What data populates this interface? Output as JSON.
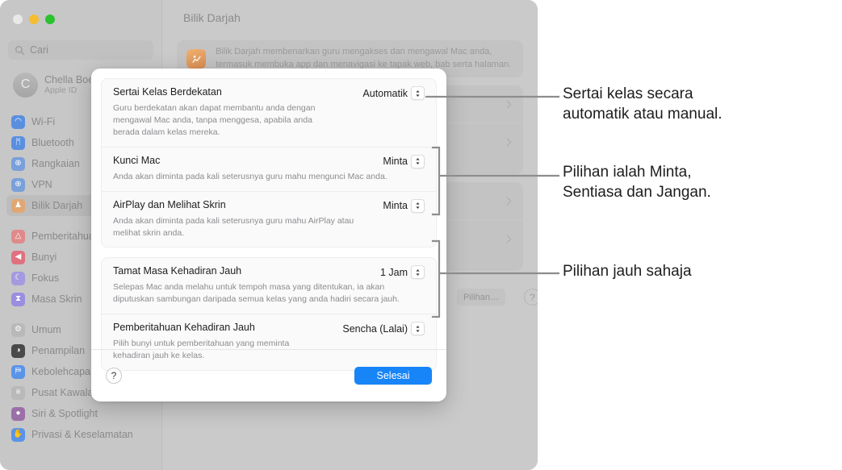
{
  "window": {
    "traffic_lights": [
      "close",
      "minimize",
      "zoom"
    ],
    "search": {
      "placeholder": "Cari",
      "value": ""
    },
    "account": {
      "name": "Chella Boe",
      "subtitle": "Apple ID",
      "initial": "C"
    },
    "sidebar_items": [
      {
        "label": "Wi-Fi",
        "icon": "wifi-icon",
        "color": "#5a8fe0",
        "glyph": "◠"
      },
      {
        "label": "Bluetooth",
        "icon": "bluetooth-icon",
        "color": "#5a8fe0",
        "glyph": "ᛗ"
      },
      {
        "label": "Rangkaian",
        "icon": "network-icon",
        "color": "#7aa0da",
        "glyph": "⊕"
      },
      {
        "label": "VPN",
        "icon": "vpn-icon",
        "color": "#7aa0da",
        "glyph": "⊕"
      },
      {
        "label": "Bilik Darjah",
        "icon": "classroom-icon",
        "color": "#e0a774",
        "glyph": "♟",
        "selected": true
      },
      {
        "gap": true
      },
      {
        "label": "Pemberitahuan",
        "icon": "notifications-icon",
        "color": "#e08a8a",
        "glyph": "△"
      },
      {
        "label": "Bunyi",
        "icon": "sound-icon",
        "color": "#e0717f",
        "glyph": "◀"
      },
      {
        "label": "Fokus",
        "icon": "focus-icon",
        "color": "#a49ae0",
        "glyph": "☾"
      },
      {
        "label": "Masa Skrin",
        "icon": "screen-time-icon",
        "color": "#9a8ee0",
        "glyph": "⧗"
      },
      {
        "gap": true
      },
      {
        "label": "Umum",
        "icon": "general-icon",
        "color": "#b9b9b9",
        "glyph": "⚙"
      },
      {
        "label": "Penampilan",
        "icon": "appearance-icon",
        "color": "#4a4a4a",
        "glyph": "◑"
      },
      {
        "label": "Kebolehcapaian",
        "icon": "accessibility-icon",
        "color": "#5a94e8",
        "glyph": "⛿"
      },
      {
        "label": "Pusat Kawalan",
        "icon": "control-center-icon",
        "color": "#b9b9b9",
        "glyph": "≡"
      },
      {
        "label": "Siri & Spotlight",
        "icon": "siri-icon",
        "color": "#9b6fa8",
        "glyph": "●"
      },
      {
        "label": "Privasi & Keselamatan",
        "icon": "privacy-icon",
        "color": "#5a94e8",
        "glyph": "✋"
      }
    ]
  },
  "background_pane": {
    "title": "Bilik Darjah",
    "banner_text": "Bilik Darjah membenarkan guru mengakses dan mengawal Mac anda,\ntermasuk membuka app dan menavigasi ke tapak web, bab serta halaman.",
    "banner_icon": "classroom-app-icon",
    "options_button": "Pilihan…",
    "help_button": "?",
    "disclosure_icon": "chevron-right-icon"
  },
  "sheet": {
    "groups": [
      {
        "options": [
          {
            "title": "Sertai Kelas Berdekatan",
            "description": "Guru berdekatan akan dapat membantu anda dengan\nmengawal Mac anda, tanpa menggesa, apabila anda\nberada dalam kelas mereka.",
            "value": "Automatik",
            "control": "popup-stepper"
          },
          {
            "title": "Kunci Mac",
            "description": "Anda akan diminta pada kali seterusnya guru mahu mengunci Mac anda.",
            "value": "Minta",
            "control": "popup-stepper"
          },
          {
            "title": "AirPlay dan Melihat Skrin",
            "description": "Anda akan diminta pada kali seterusnya guru mahu AirPlay atau\nmelihat skrin anda.",
            "value": "Minta",
            "control": "popup-stepper"
          }
        ]
      },
      {
        "options": [
          {
            "title": "Tamat Masa Kehadiran Jauh",
            "description": "Selepas Mac anda melahu untuk tempoh masa yang ditentukan, ia akan\ndiputuskan sambungan daripada semua kelas yang anda hadiri secara jauh.",
            "value": "1 Jam",
            "control": "popup-stepper"
          },
          {
            "title": "Pemberitahuan Kehadiran Jauh",
            "description": "Pilih bunyi untuk pemberitahuan yang meminta\nkehadiran jauh ke kelas.",
            "value": "Sencha (Lalai)",
            "control": "popup-stepper"
          }
        ]
      }
    ],
    "help_button": "?",
    "done_button": "Selesai",
    "done_button_color": "#1785f8"
  },
  "callouts": [
    {
      "text": "Sertai kelas secara\nautomatik atau manual.",
      "connector": "line"
    },
    {
      "text": "Pilihan ialah Minta,\nSentiasa dan Jangan.",
      "connector": "bracket"
    },
    {
      "text": "Pilihan jauh sahaja",
      "connector": "bracket"
    }
  ]
}
